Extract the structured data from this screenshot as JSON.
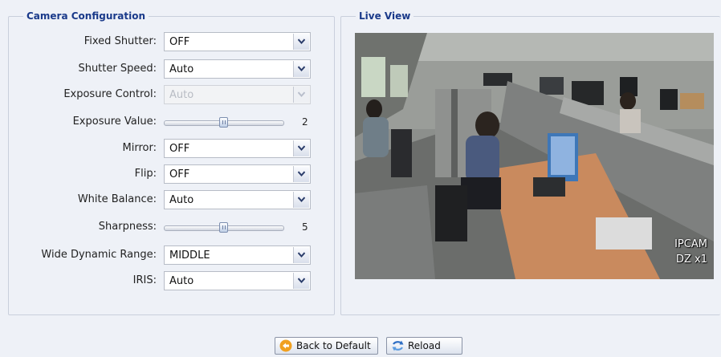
{
  "camera_config": {
    "title": "Camera Configuration",
    "fields": {
      "fixed_shutter": {
        "label": "Fixed Shutter:",
        "value": "OFF"
      },
      "shutter_speed": {
        "label": "Shutter Speed:",
        "value": "Auto"
      },
      "exposure_control": {
        "label": "Exposure Control:",
        "value": "Auto",
        "disabled": true
      },
      "exposure_value": {
        "label": "Exposure Value:",
        "value": "2",
        "level_fraction": 0.5
      },
      "mirror": {
        "label": "Mirror:",
        "value": "OFF"
      },
      "flip": {
        "label": "Flip:",
        "value": "OFF"
      },
      "white_balance": {
        "label": "White Balance:",
        "value": "Auto"
      },
      "sharpness": {
        "label": "Sharpness:",
        "value": "5",
        "level_fraction": 0.5
      },
      "wdr": {
        "label": "Wide Dynamic Range:",
        "value": "MIDDLE"
      },
      "iris": {
        "label": "IRIS:",
        "value": "Auto"
      }
    }
  },
  "live_view": {
    "title": "Live View",
    "osd_line1": "IPCAM",
    "osd_line2": "DZ x1"
  },
  "buttons": {
    "back_to_default": "Back to Default",
    "reload": "Reload"
  },
  "colors": {
    "page_bg": "#eef1f7",
    "legend_text": "#1a3a8a",
    "group_border": "#c9cfdc"
  }
}
